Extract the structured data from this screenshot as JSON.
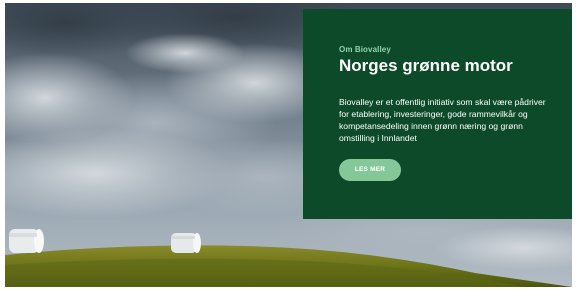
{
  "hero": {
    "image": "sky-with-hay-bales-field",
    "card": {
      "eyebrow": "Om Biovalley",
      "title": "Norges grønne motor",
      "body": "Biovalley er et offentlig initiativ som skal være pådriver for etablering, investeringer, gode rammevilkår og kompetansedeling innen grønn næring og grønn omstilling i Innlandet",
      "button_label": "LES MER"
    }
  },
  "colors": {
    "card_background": "#0d4a2a",
    "eyebrow_text": "#8fd3a8",
    "button_background": "#86c79a"
  }
}
